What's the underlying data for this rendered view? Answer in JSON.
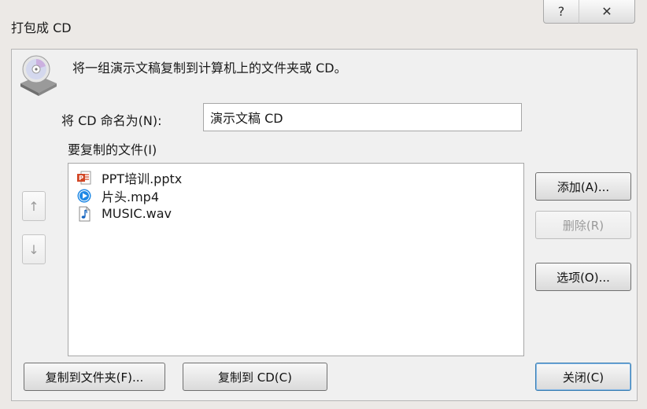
{
  "window": {
    "title": "打包成 CD",
    "help_glyph": "?",
    "close_glyph": "✕"
  },
  "header": {
    "description": "将一组演示文稿复制到计算机上的文件夹或 CD。"
  },
  "name_field": {
    "label": "将 CD 命名为(N):",
    "value": "演示文稿 CD"
  },
  "files": {
    "label": "要复制的文件(I)",
    "items": [
      {
        "name": "PPT培训.pptx",
        "icon": "powerpoint-file-icon"
      },
      {
        "name": "片头.mp4",
        "icon": "video-file-icon"
      },
      {
        "name": "MUSIC.wav",
        "icon": "audio-file-icon"
      }
    ]
  },
  "side_buttons": {
    "up": "↑",
    "down": "↓"
  },
  "buttons": {
    "add": "添加(A)...",
    "remove": "删除(R)",
    "options": "选项(O)...",
    "copy_to_folder": "复制到文件夹(F)...",
    "copy_to_cd": "复制到 CD(C)",
    "close": "关闭(C)"
  },
  "colors": {
    "accent": "#3c7fb1",
    "pptx": "#d24726",
    "video": "#1e88e5",
    "audio": "#1565c0"
  }
}
